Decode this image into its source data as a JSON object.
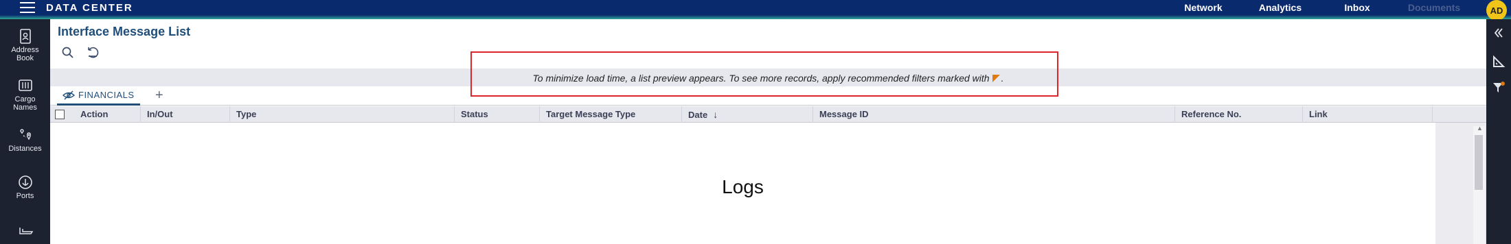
{
  "app": {
    "title": "DATA CENTER"
  },
  "topnav": {
    "items": [
      {
        "label": "Network",
        "enabled": true
      },
      {
        "label": "Analytics",
        "enabled": true
      },
      {
        "label": "Inbox",
        "enabled": true
      },
      {
        "label": "Documents",
        "enabled": false
      }
    ],
    "avatar_initials": "AD"
  },
  "sidebar": {
    "items": [
      {
        "label": "Address Book",
        "icon": "address-book-icon"
      },
      {
        "label": "Cargo Names",
        "icon": "cargo-icon"
      },
      {
        "label": "Distances",
        "icon": "distances-icon"
      },
      {
        "label": "Ports",
        "icon": "anchor-icon"
      },
      {
        "label": "",
        "icon": "vessel-icon"
      }
    ]
  },
  "rightrail": {
    "icons": [
      "collapse-icon",
      "ruler-icon",
      "filter-icon"
    ]
  },
  "page": {
    "title": "Interface Message List"
  },
  "toolbar": {
    "icons": [
      "search-icon",
      "reset-icon"
    ]
  },
  "banner": {
    "text": "To minimize load time, a list preview appears. To see more records, apply recommended filters marked with",
    "suffix": "."
  },
  "tabs": {
    "items": [
      {
        "label": "FINANCIALS",
        "active": true
      }
    ],
    "add_label": "+"
  },
  "grid": {
    "columns": [
      "Action",
      "In/Out",
      "Type",
      "Status",
      "Target Message Type",
      "Date",
      "Message ID",
      "Reference No.",
      "Link"
    ],
    "sort_column": "Date",
    "sort_direction": "descending",
    "empty_text": "Logs"
  },
  "colors": {
    "topbar": "#0a2a6e",
    "sidebar": "#1c2230",
    "accent": "#1f4e79",
    "highlight": "#e0242b",
    "flag": "#e07b12",
    "avatar": "#f0c419"
  }
}
